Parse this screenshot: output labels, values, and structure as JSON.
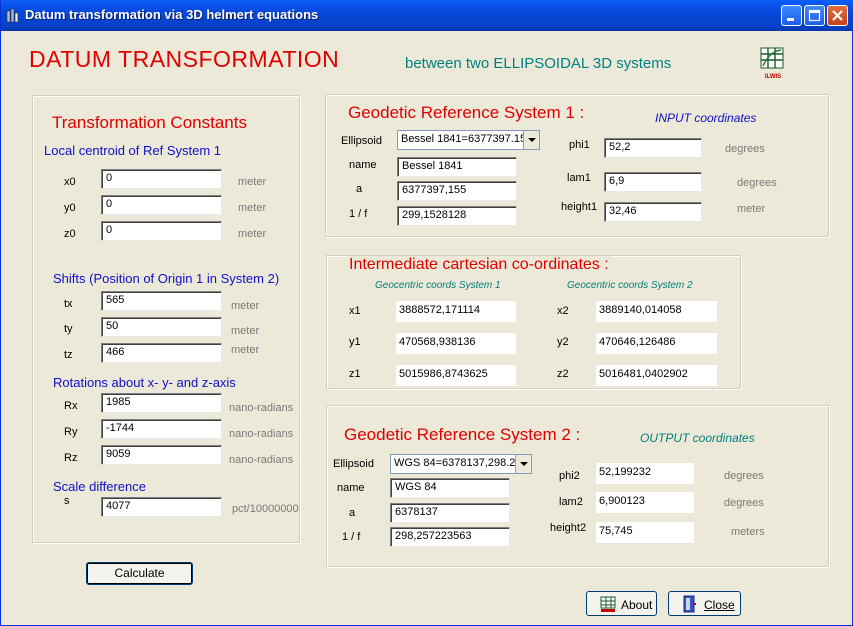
{
  "window": {
    "title": "Datum transformation via 3D helmert equations"
  },
  "header": {
    "title": "DATUM  TRANSFORMATION",
    "subtitle": "between two ELLIPSOIDAL 3D systems",
    "logo_text": "ILWIS"
  },
  "constants": {
    "title": "Transformation Constants",
    "local_centroid": {
      "heading": "Local centroid of Ref System 1",
      "x0": {
        "label": "x0",
        "value": "0",
        "unit": "meter"
      },
      "y0": {
        "label": "y0",
        "value": "0",
        "unit": "meter"
      },
      "z0": {
        "label": "z0",
        "value": "0",
        "unit": "meter"
      }
    },
    "shifts": {
      "heading": "Shifts (Position of Origin 1 in System 2)",
      "tx": {
        "label": "tx",
        "value": "565",
        "unit": "meter"
      },
      "ty": {
        "label": "ty",
        "value": "50",
        "unit": "meter"
      },
      "tz": {
        "label": "tz",
        "value": "466",
        "unit": "meter"
      }
    },
    "rotations": {
      "heading": "Rotations about  x- y- and z-axis",
      "rx": {
        "label": "Rx",
        "value": "1985",
        "unit": "nano-radians"
      },
      "ry": {
        "label": "Ry",
        "value": "-1744",
        "unit": "nano-radians"
      },
      "rz": {
        "label": "Rz",
        "value": "9059",
        "unit": "nano-radians"
      }
    },
    "scale": {
      "heading": "Scale difference",
      "label": "s",
      "value": "4077",
      "unit": "pct/10000000"
    }
  },
  "system1": {
    "title": "Geodetic Reference System 1 :",
    "tag": "INPUT coordinates",
    "ellipsoid_label": "Ellipsoid",
    "ellipsoid_value": "Bessel 1841=6377397.15",
    "name_label": "name",
    "name_value": "Bessel 1841",
    "a_label": "a",
    "a_value": "6377397,155",
    "f_label": "1 / f",
    "f_value": "299,1528128",
    "phi_label": "phi1",
    "phi_value": "52,2",
    "phi_unit": "degrees",
    "lam_label": "lam1",
    "lam_value": "6,9",
    "lam_unit": "degrees",
    "height_label": "height1",
    "height_value": "32,46",
    "height_unit": "meter"
  },
  "intermediate": {
    "title": "Intermediate  cartesian co-ordinates :",
    "col1": "Geocentric coords System 1",
    "col2": "Geocentric coords System 2",
    "x1_label": "x1",
    "x1": "3888572,171114",
    "y1_label": "y1",
    "y1": "470568,938136",
    "z1_label": "z1",
    "z1": "5015986,8743625",
    "x2_label": "x2",
    "x2": "3889140,014058",
    "y2_label": "y2",
    "y2": "470646,126486",
    "z2_label": "z2",
    "z2": "5016481,0402902"
  },
  "system2": {
    "title": "Geodetic Reference System 2 :",
    "tag": "OUTPUT coordinates",
    "ellipsoid_label": "Ellipsoid",
    "ellipsoid_value": "WGS 84=6378137,298.2",
    "name_label": "name",
    "name_value": "WGS 84",
    "a_label": "a",
    "a_value": "6378137",
    "f_label": "1 / f",
    "f_value": "298,257223563",
    "phi_label": "phi2",
    "phi_value": "52,199232",
    "phi_unit": "degrees",
    "lam_label": "lam2",
    "lam_value": "6,900123",
    "lam_unit": "degrees",
    "height_label": "height2",
    "height_value": "75,745",
    "height_unit": "meters"
  },
  "buttons": {
    "calculate": "Calculate",
    "about": "About",
    "close": "Close"
  },
  "colors": {
    "title_red": "#e00000",
    "heading_blue": "#1010c8",
    "teal": "#008080",
    "titlebar_blue": "#0747d9"
  },
  "icons": {
    "app": "app-icon",
    "minimize": "minimize-icon",
    "maximize": "maximize-icon",
    "close": "close-icon",
    "logo": "ilwis-logo-icon"
  }
}
